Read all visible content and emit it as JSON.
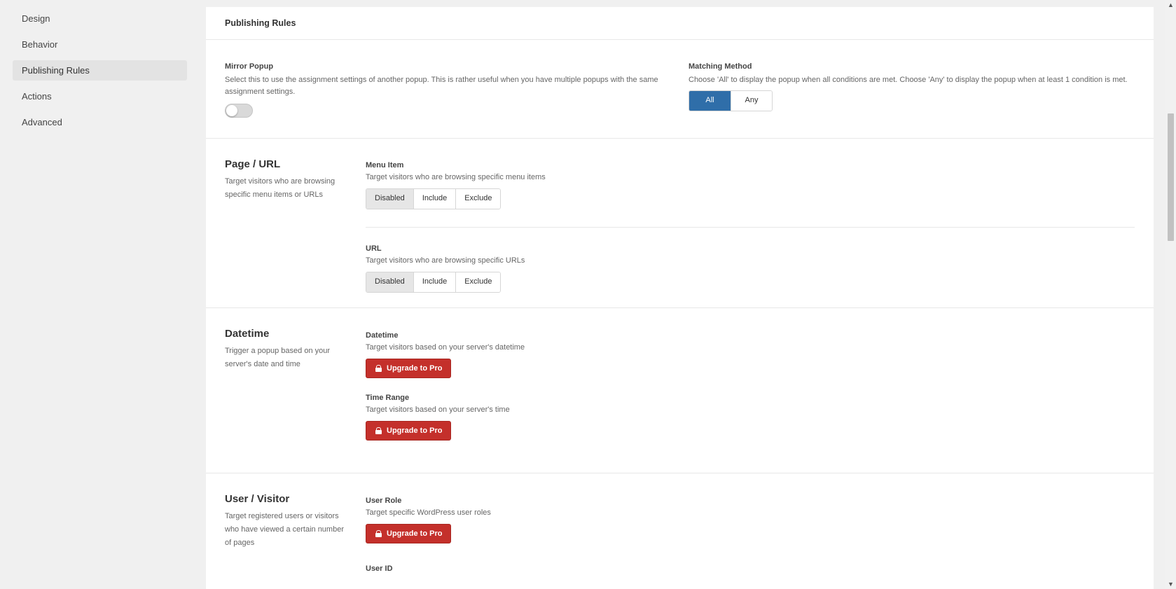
{
  "sidebar": {
    "items": [
      {
        "label": "Design"
      },
      {
        "label": "Behavior"
      },
      {
        "label": "Publishing Rules"
      },
      {
        "label": "Actions"
      },
      {
        "label": "Advanced"
      }
    ]
  },
  "panel": {
    "title": "Publishing Rules",
    "mirror": {
      "label": "Mirror Popup",
      "desc": "Select this to use the assignment settings of another popup. This is rather useful when you have multiple popups with the same assignment settings.",
      "enabled": false
    },
    "matching": {
      "label": "Matching Method",
      "desc": "Choose 'All' to display the popup when all conditions are met. Choose 'Any' to display the popup when at least 1 condition is met.",
      "options": [
        "All",
        "Any"
      ],
      "selected": "All"
    }
  },
  "sections": {
    "page_url": {
      "title": "Page / URL",
      "desc": "Target visitors who are browsing specific menu items or URLs",
      "menu_item": {
        "label": "Menu Item",
        "desc": "Target visitors who are browsing specific menu items",
        "options": [
          "Disabled",
          "Include",
          "Exclude"
        ],
        "selected": "Disabled"
      },
      "url": {
        "label": "URL",
        "desc": "Target visitors who are browsing specific URLs",
        "options": [
          "Disabled",
          "Include",
          "Exclude"
        ],
        "selected": "Disabled"
      }
    },
    "datetime": {
      "title": "Datetime",
      "desc": "Trigger a popup based on your server's date and time",
      "datetime_field": {
        "label": "Datetime",
        "desc": "Target visitors based on your server's datetime",
        "button": "Upgrade to Pro"
      },
      "time_range": {
        "label": "Time Range",
        "desc": "Target visitors based on your server's time",
        "button": "Upgrade to Pro"
      }
    },
    "user_visitor": {
      "title": "User / Visitor",
      "desc": "Target registered users or visitors who have viewed a certain number of pages",
      "user_role": {
        "label": "User Role",
        "desc": "Target specific WordPress user roles",
        "button": "Upgrade to Pro"
      },
      "user_id": {
        "label": "User ID"
      }
    }
  },
  "colors": {
    "primary": "#2f6ea9",
    "pro_button": "#c4302b",
    "background": "#f0f0f0"
  }
}
